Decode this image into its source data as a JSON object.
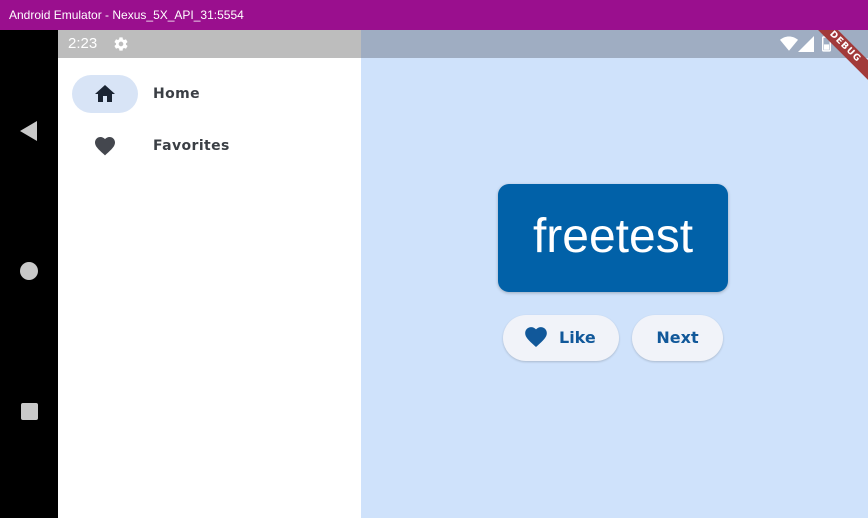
{
  "window": {
    "title": "Android Emulator - Nexus_5X_API_31:5554"
  },
  "status_bar": {
    "time": "2:23",
    "icons": [
      "gear-icon",
      "wifi-icon",
      "signal-icon",
      "battery-icon"
    ]
  },
  "debug_banner": {
    "label": "DEBUG"
  },
  "navigation": {
    "items": [
      {
        "label": "Home",
        "icon": "home-icon",
        "selected": true
      },
      {
        "label": "Favorites",
        "icon": "heart-icon",
        "selected": false
      }
    ]
  },
  "main": {
    "word": "freetest",
    "like_button": {
      "label": "Like",
      "icon": "heart-icon"
    },
    "next_button": {
      "label": "Next"
    }
  },
  "colors": {
    "window_frame": "#9a0f8e",
    "background": "#cfe2fb",
    "card": "#0161a8",
    "button_text": "#11589a",
    "rail_indicator": "#d8e4f6"
  }
}
